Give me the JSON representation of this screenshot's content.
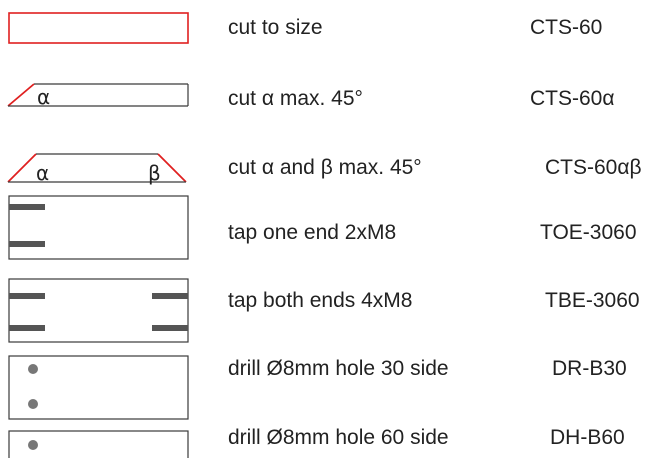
{
  "colors": {
    "cut_line": "#e02020",
    "outline": "#3a3a3a",
    "tap_mark": "#555555",
    "hole": "#777777"
  },
  "rows": [
    {
      "description": "cut to size",
      "code": "CTS-60"
    },
    {
      "description": "cut α max. 45°",
      "code": "CTS-60α"
    },
    {
      "description": "cut α and β max. 45°",
      "code": "CTS-60αβ"
    },
    {
      "description": "tap one end 2xM8",
      "code": "TOE-3060"
    },
    {
      "description": "tap both ends 4xM8",
      "code": "TBE-3060"
    },
    {
      "description": "drill Ø8mm hole 30 side",
      "code": "DR-B30"
    },
    {
      "description": "drill Ø8mm hole 60 side",
      "code": "DH-B60"
    }
  ],
  "shape_labels": {
    "alpha": "α",
    "beta": "β"
  }
}
